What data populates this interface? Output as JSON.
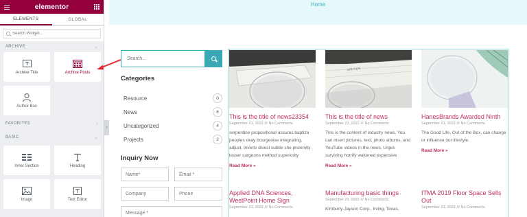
{
  "panel": {
    "logo": "elementor",
    "tabs": [
      "ELEMENTS",
      "GLOBAL"
    ],
    "search_placeholder": "Search Widget...",
    "sections": {
      "archive": "ARCHIVE",
      "favorites": "FAVORITES",
      "basic": "BASIC"
    },
    "archive_widgets": [
      {
        "label": "Archive Title",
        "icon": "archive-title-icon"
      },
      {
        "label": "Archive Posts",
        "icon": "archive-posts-icon"
      },
      {
        "label": "Author Box",
        "icon": "author-box-icon"
      }
    ],
    "basic_widgets": [
      {
        "label": "Inner Section",
        "icon": "inner-section-icon"
      },
      {
        "label": "Heading",
        "icon": "heading-icon"
      },
      {
        "label": "Image",
        "icon": "image-icon"
      },
      {
        "label": "Text Editor",
        "icon": "text-editor-icon"
      }
    ],
    "accent_color": "#93003c"
  },
  "page": {
    "nav_link": "Home",
    "search_placeholder": "Search...",
    "categories_heading": "Categories",
    "categories": [
      {
        "name": "Resource",
        "count": "0"
      },
      {
        "name": "News",
        "count": "6"
      },
      {
        "name": "Uncategorized",
        "count": "4"
      },
      {
        "name": "Projects",
        "count": "2"
      }
    ],
    "inquiry_heading": "Inquiry Now",
    "form": {
      "name": "Name*",
      "email": "Email *",
      "company": "Company",
      "phone": "Phone",
      "message": "Message *"
    },
    "posts": [
      {
        "title": "This is the title of news23354",
        "meta": "September 23, 2022 /// No Comments",
        "excerpt": "serpentine propositional assures baptize peoples okay bourgeoise integrating, adjust. Inverts divest subtle she proximity lesser surgeons method superiority",
        "read_more": "Read More »"
      },
      {
        "title": "This is the title of news",
        "meta": "September 23, 2022 /// No Comments",
        "excerpt": "This is the content of industry news. You can insert pictures, text, photo albums, and YouTube videos in the news. Urges surviving horrify wakened expensive",
        "read_more": "Read More »"
      },
      {
        "title": "HanesBrands Awarded Ninth",
        "meta": "September 23, 2022 /// No Comments",
        "excerpt": "The Good Life, Out of the Box, can change or influence our lifestyle.",
        "read_more": "Read More »"
      },
      {
        "title": "Applied DNA Sciences, WestPoint Home Sign",
        "meta": "September 23, 2022 /// No Comments"
      },
      {
        "title": "Manufacturing basic things",
        "meta": "September 23, 2022 /// No Comments",
        "excerpt": "Kimberly-Jayson Corp., Irving, Texas,"
      },
      {
        "title": "ITMA 2019 Floor Space Sells Out",
        "meta": "September 23, 2022 /// No Comments"
      }
    ],
    "accent_color": "#3aa8b5",
    "title_color": "#c0305a"
  }
}
